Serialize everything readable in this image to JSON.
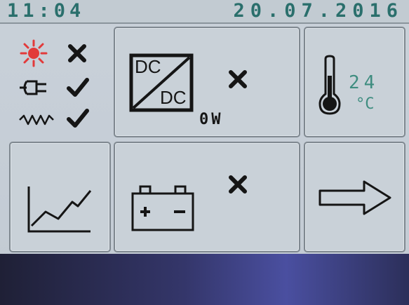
{
  "header": {
    "time": "11:04",
    "date": "20.07.2016"
  },
  "status": {
    "items": [
      {
        "icon": "sun-icon",
        "state": "inactive"
      },
      {
        "icon": "plug-icon",
        "state": "active"
      },
      {
        "icon": "ac-wave-icon",
        "state": "active"
      }
    ]
  },
  "dcdc": {
    "icon": "dc-dc-converter-icon",
    "label_top": "DC",
    "label_bottom": "DC",
    "state": "inactive",
    "power": "0W"
  },
  "temperature": {
    "icon": "thermometer-icon",
    "value": "24",
    "unit": "°C"
  },
  "chart_tile": {
    "icon": "line-chart-icon"
  },
  "battery": {
    "icon": "battery-icon",
    "state": "inactive"
  },
  "next": {
    "icon": "arrow-right-icon"
  },
  "colors": {
    "screen_bg": "#c9d1d8",
    "header_text": "#2a6f6c",
    "temp_text": "#3f8d80",
    "icon_dark": "#151515",
    "sun_red": "#e23a3a"
  }
}
